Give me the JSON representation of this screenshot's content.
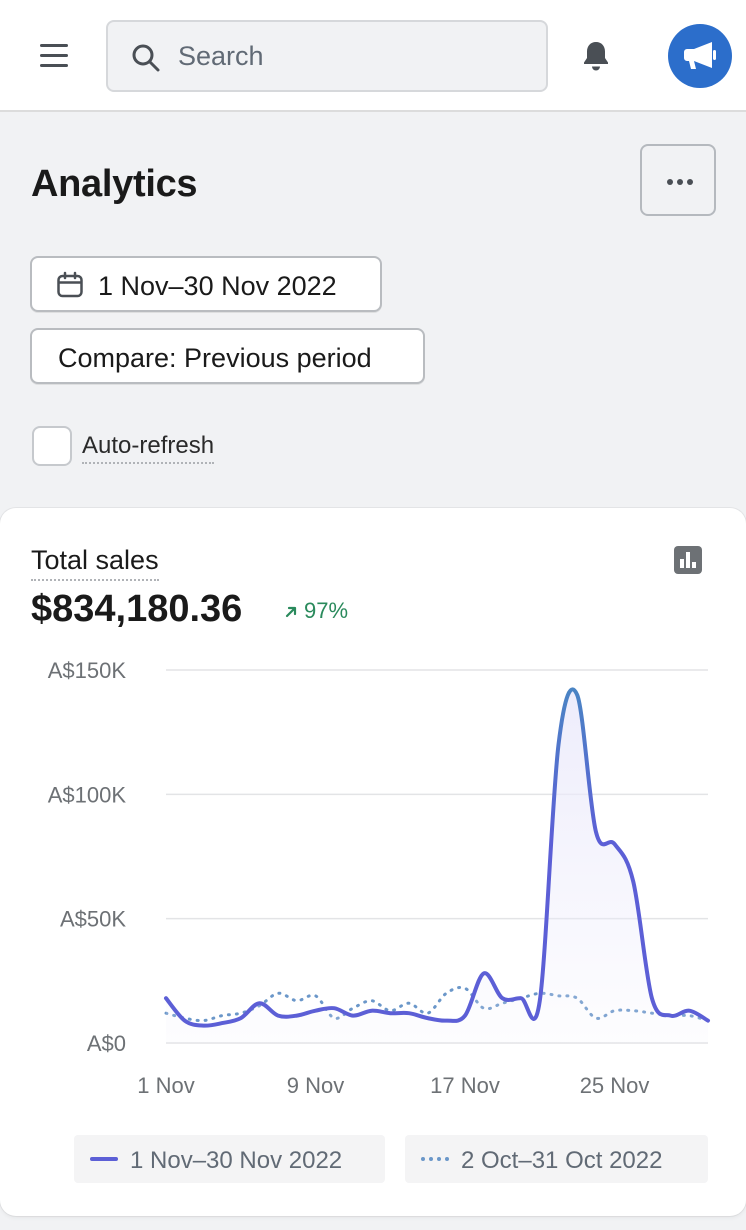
{
  "topbar": {
    "search_placeholder": "Search",
    "icons": [
      "menu-icon",
      "search-icon",
      "bell-icon",
      "megaphone-icon"
    ]
  },
  "page": {
    "title": "Analytics"
  },
  "filters": {
    "date_range": "1 Nov–30 Nov 2022",
    "compare": "Compare: Previous period",
    "auto_refresh_label": "Auto-refresh",
    "auto_refresh_checked": false
  },
  "card": {
    "title": "Total sales",
    "value": "$834,180.36",
    "change": "97%",
    "change_direction": "up",
    "change_color": "#2a8a5c"
  },
  "colors": {
    "current_series": "#5c5fd6",
    "current_peak": "#4a84c4",
    "previous_series": "#6b97c9",
    "brand": "#2c6ecb"
  },
  "chart_data": {
    "type": "line",
    "title": "",
    "xlabel": "",
    "ylabel": "",
    "y_tick_labels": [
      "A$0",
      "A$50K",
      "A$100K",
      "A$150K"
    ],
    "x_tick_labels": [
      "1 Nov",
      "9 Nov",
      "17 Nov",
      "25 Nov"
    ],
    "ylim": [
      0,
      150000
    ],
    "grid": true,
    "legend_position": "bottom",
    "series": [
      {
        "name": "1 Nov–30 Nov 2022",
        "style": "solid",
        "x": [
          "1 Nov",
          "2 Nov",
          "3 Nov",
          "4 Nov",
          "5 Nov",
          "6 Nov",
          "7 Nov",
          "8 Nov",
          "9 Nov",
          "10 Nov",
          "11 Nov",
          "12 Nov",
          "13 Nov",
          "14 Nov",
          "15 Nov",
          "16 Nov",
          "17 Nov",
          "18 Nov",
          "19 Nov",
          "20 Nov",
          "21 Nov",
          "22 Nov",
          "23 Nov",
          "24 Nov",
          "25 Nov",
          "26 Nov",
          "27 Nov",
          "28 Nov",
          "29 Nov",
          "30 Nov"
        ],
        "values": [
          18000,
          9000,
          7000,
          8000,
          10000,
          16000,
          11000,
          11000,
          13000,
          14000,
          11000,
          13000,
          12000,
          12000,
          10000,
          9000,
          11000,
          28000,
          18000,
          18000,
          17000,
          120000,
          140000,
          85000,
          80000,
          65000,
          18000,
          11000,
          13000,
          9000
        ]
      },
      {
        "name": "2 Oct–31 Oct 2022",
        "style": "dotted",
        "x": [
          "1 Nov",
          "2 Nov",
          "3 Nov",
          "4 Nov",
          "5 Nov",
          "6 Nov",
          "7 Nov",
          "8 Nov",
          "9 Nov",
          "10 Nov",
          "11 Nov",
          "12 Nov",
          "13 Nov",
          "14 Nov",
          "15 Nov",
          "16 Nov",
          "17 Nov",
          "18 Nov",
          "19 Nov",
          "20 Nov",
          "21 Nov",
          "22 Nov",
          "23 Nov",
          "24 Nov",
          "25 Nov",
          "26 Nov",
          "27 Nov",
          "28 Nov",
          "29 Nov",
          "30 Nov"
        ],
        "values": [
          12000,
          10000,
          9000,
          11000,
          12000,
          15000,
          20000,
          17000,
          19000,
          10000,
          14000,
          17000,
          13000,
          16000,
          12000,
          20000,
          22000,
          14000,
          16000,
          18000,
          20000,
          19000,
          18000,
          10000,
          13000,
          13000,
          12000,
          11000,
          11000,
          9000
        ]
      }
    ]
  }
}
